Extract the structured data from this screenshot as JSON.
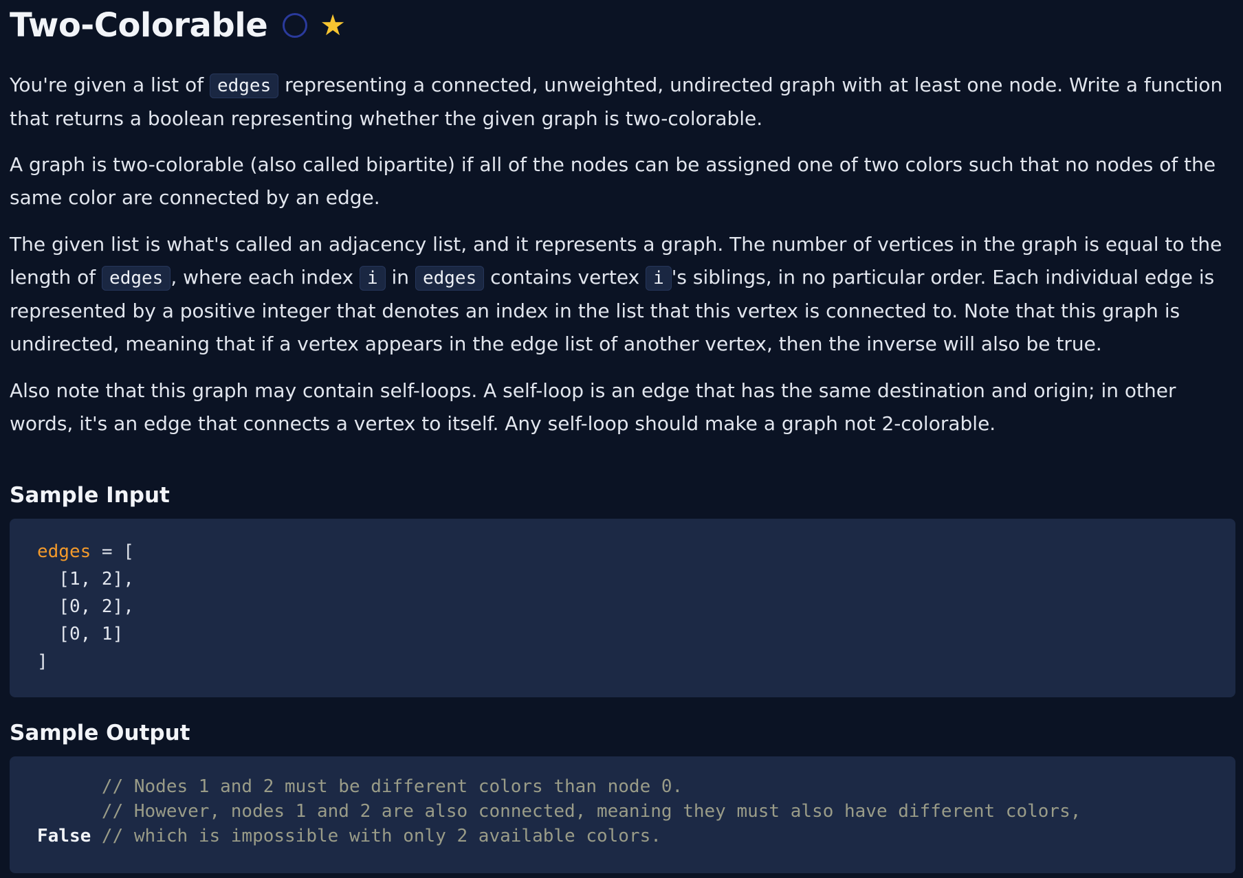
{
  "title": "Two-Colorable",
  "icons": {
    "status": "circle-outline-icon",
    "favorite": "star-icon",
    "status_color": "#2a3a9c",
    "favorite_color": "#f7c531"
  },
  "description": {
    "p1": {
      "before": "You're given a list of ",
      "code": "edges",
      "after": " representing a connected, unweighted, undirected graph with at least one node. Write a function that returns a boolean representing whether the given graph is two-colorable."
    },
    "p2": "A graph is two-colorable (also called bipartite) if all of the nodes can be assigned one of two colors such that no nodes of the same color are connected by an edge.",
    "p3": {
      "t1": "The given list is what's called an adjacency list, and it represents a graph. The number of vertices in the graph is equal to the length of ",
      "c1": "edges",
      "t2": ", where each index ",
      "c2": "i",
      "t3": " in ",
      "c3": "edges",
      "t4": " contains vertex ",
      "c4": "i",
      "t5": "'s siblings, in no particular order. Each individual edge is represented by a positive integer that denotes an index in the list that this vertex is connected to. Note that this graph is undirected, meaning that if a vertex appears in the edge list of another vertex, then the inverse will also be true."
    },
    "p4": "Also note that this graph may contain self-loops. A self-loop is an edge that has the same destination and origin; in other words, it's an edge that connects a vertex to itself. Any self-loop should make a graph not 2-colorable."
  },
  "sample_input": {
    "heading": "Sample Input",
    "var_name": "edges",
    "assign": " = [",
    "lines": [
      "  [1, 2],",
      "  [0, 2],",
      "  [0, 1]",
      "]"
    ]
  },
  "sample_output": {
    "heading": "Sample Output",
    "comment1": "      // Nodes 1 and 2 must be different colors than node 0.",
    "comment2": "      // However, nodes 1 and 2 are also connected, meaning they must also have different colors,",
    "value": "False",
    "comment3": " // which is impossible with only 2 available colors."
  },
  "colors": {
    "background": "#0b1324",
    "code_background": "#1c2945",
    "variable": "#f39a2b",
    "comment": "#9a9c88"
  }
}
